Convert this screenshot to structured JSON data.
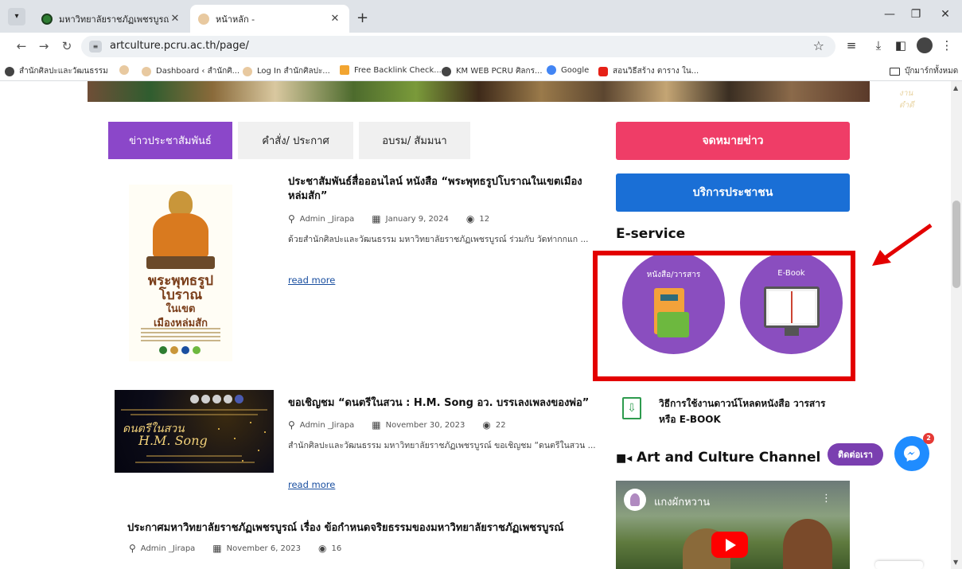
{
  "browser": {
    "tabs": [
      {
        "title": "มหาวิทยาลัยราชภัฏเพชรบูรณ์",
        "active": false
      },
      {
        "title": "หน้าหลัก -",
        "active": true
      }
    ],
    "url": "artculture.pcru.ac.th/page/",
    "bookmarks": [
      "สำนักศิลปะและวัฒนธรรม",
      "",
      "Dashboard ‹ สำนักศิ...",
      "Log In สำนักศิลปะ...",
      "Free Backlink Check...",
      "KM WEB PCRU ศิลกร...",
      "Google",
      "สอนวิธีสร้าง ตาราง ใน...",
      "บุ๊กมาร์กทั้งหมด"
    ],
    "colors": {
      "accent": "#8b47c9",
      "highlight": "#e30000"
    }
  },
  "page": {
    "banner_text": "งานดำดี",
    "news_tabs": [
      "ข่าวประชาสัมพันธ์",
      "คำสั่ง/ ประกาศ",
      "อบรม/ สัมมนา"
    ],
    "posts": [
      {
        "title": "ประชาสัมพันธ์สื่อออนไลน์ หนังสือ “พระพุทธรูปโบราณในเขตเมืองหล่มสัก”",
        "author": "Admin _Jirapa",
        "date": "January 9, 2024",
        "views": "12",
        "excerpt": "ด้วยสำนักศิลปะและวัฒนธรรม มหาวิทยาลัยราชภัฏเพชรบูรณ์ ร่วมกับ วัดท่ากกแก ...",
        "read_more": "read more",
        "thumb_title_1": "พระพุทธรูป",
        "thumb_title_2": "โบราณ",
        "thumb_title_3": "ในเขต",
        "thumb_title_4": "เมืองหล่มสัก"
      },
      {
        "title": "ขอเชิญชม “ดนตรีในสวน : H.M. Song อว. บรรเลงเพลงของพ่อ”",
        "author": "Admin _Jirapa",
        "date": "November 30, 2023",
        "views": "22",
        "excerpt": "สำนักศิลปะและวัฒนธรรม มหาวิทยาลัยราชภัฏเพชรบูรณ์ ขอเชิญชม “ดนตรีในสวน ...",
        "read_more": "read more",
        "thumb_line_1": "ดนตรีในสวน",
        "thumb_line_2": "H.M. Song"
      },
      {
        "title": "ประกาศมหาวิทยาลัยราชภัฏเพชรบูรณ์ เรื่อง ข้อกำหนดจริยธรรมของมหาวิทยาลัยราชภัฏเพชรบูรณ์",
        "author": "Admin _Jirapa",
        "date": "November 6, 2023",
        "views": "16"
      }
    ]
  },
  "sidebar": {
    "newsletter_button": "จดหมายข่าว",
    "public_service_button": "บริการประชาชน",
    "eservice_heading": "E-service",
    "eservice_items": [
      "หนังสือ/วารสาร",
      "E-Book"
    ],
    "download_guide": "วิธีการใช้งานดาวน์โหลดหนังสือ วารสาร หรือ E-BOOK",
    "channel_heading": "Art and Culture Channel",
    "video_title": "แกงผักหวาน"
  },
  "chat": {
    "contact_label": "ติดต่อเรา",
    "badge_count": "2"
  }
}
